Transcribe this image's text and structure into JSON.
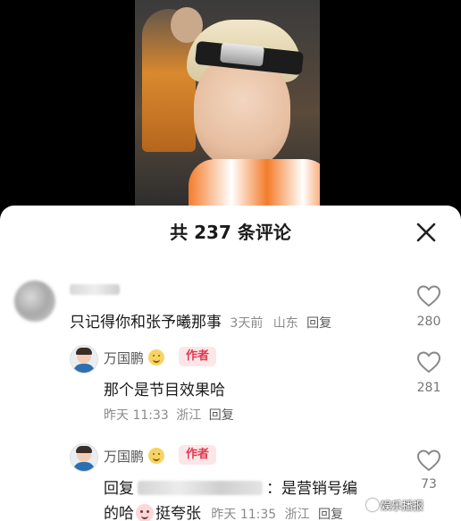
{
  "sheet": {
    "title": "共 237 条评论"
  },
  "comments": [
    {
      "text": "只记得你和张予曦那事",
      "time": "3天前",
      "location": "山东",
      "reply_label": "回复",
      "likes": "280"
    },
    {
      "author": "万国鹏",
      "author_tag": "作者",
      "text": "那个是节目效果哈",
      "time": "昨天 11:33",
      "location": "浙江",
      "reply_label": "回复",
      "likes": "281"
    },
    {
      "author": "万国鹏",
      "author_tag": "作者",
      "reply_prefix": "回复",
      "reply_text_1": "：是营销号编",
      "reply_text_2a": "的哈",
      "reply_text_2b": "挺夸张",
      "time": "昨天 11:35",
      "location": "浙江",
      "reply_label": "回复",
      "likes": "73"
    }
  ],
  "watermark": "娱乐播报",
  "colors": {
    "accent": "#e0394f",
    "tag_bg": "#fde6e8",
    "meta": "#8a8a8a"
  },
  "icons": [
    "close-icon",
    "heart-icon",
    "smile-emoji",
    "blush-emoji"
  ]
}
